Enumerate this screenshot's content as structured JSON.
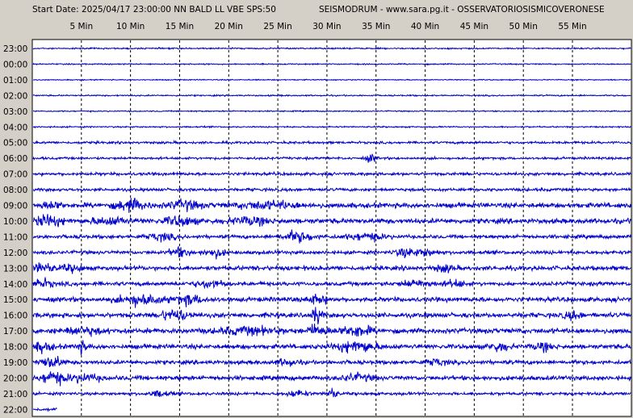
{
  "header": {
    "left": "Start Date: 2025/04/17 23:00:00 NN BALD LL VBE SPS:50",
    "right": "SEISMODRUM - www.sara.pg.it - OSSERVATORIOSISMICOVERONESE"
  },
  "colors": {
    "background": "#d4d0c8",
    "plot_background": "#ffffff",
    "trace": "#0000cc",
    "grid": "#000000"
  },
  "chart_data": {
    "type": "line",
    "title": "",
    "xlabel": "",
    "ylabel": "",
    "x_unit": "minutes",
    "xlim": [
      0,
      61
    ],
    "x_ticks": [
      {
        "value": 5,
        "label": "5 Min"
      },
      {
        "value": 10,
        "label": "10 Min"
      },
      {
        "value": 15,
        "label": "15 Min"
      },
      {
        "value": 20,
        "label": "20 Min"
      },
      {
        "value": 25,
        "label": "25 Min"
      },
      {
        "value": 30,
        "label": "30 Min"
      },
      {
        "value": 35,
        "label": "35 Min"
      },
      {
        "value": 40,
        "label": "40 Min"
      },
      {
        "value": 45,
        "label": "45 Min"
      },
      {
        "value": 50,
        "label": "50 Min"
      },
      {
        "value": 55,
        "label": "55 Min"
      }
    ],
    "grid": "vertical dashed",
    "rows": [
      {
        "label": "23:00",
        "base": 0.7,
        "bursts": []
      },
      {
        "label": "00:00",
        "base": 0.6,
        "bursts": []
      },
      {
        "label": "01:00",
        "base": 0.5,
        "bursts": []
      },
      {
        "label": "02:00",
        "base": 0.7,
        "bursts": []
      },
      {
        "label": "03:00",
        "base": 0.6,
        "bursts": []
      },
      {
        "label": "04:00",
        "base": 0.7,
        "bursts": []
      },
      {
        "label": "05:00",
        "base": 1.2,
        "bursts": []
      },
      {
        "label": "06:00",
        "base": 1.2,
        "bursts": [
          [
            34.5,
            0.5,
            4
          ]
        ]
      },
      {
        "label": "07:00",
        "base": 1.5,
        "bursts": []
      },
      {
        "label": "08:00",
        "base": 1.5,
        "bursts": []
      },
      {
        "label": "09:00",
        "base": 2.5,
        "bursts": [
          [
            10,
            1.5,
            5
          ],
          [
            15.5,
            1.5,
            4
          ],
          [
            24,
            3,
            3
          ],
          [
            2,
            1,
            3
          ]
        ]
      },
      {
        "label": "10:00",
        "base": 2.5,
        "bursts": [
          [
            1.5,
            1.5,
            5
          ],
          [
            8,
            2,
            3
          ],
          [
            15,
            1.5,
            4
          ],
          [
            22,
            2,
            3
          ]
        ]
      },
      {
        "label": "11:00",
        "base": 1.8,
        "bursts": [
          [
            13,
            1.5,
            3
          ],
          [
            27,
            1.5,
            5
          ],
          [
            34,
            2,
            3
          ]
        ]
      },
      {
        "label": "12:00",
        "base": 1.8,
        "bursts": [
          [
            15,
            1,
            4
          ],
          [
            18.5,
            1,
            4
          ],
          [
            38,
            1,
            4
          ],
          [
            40,
            1,
            3
          ]
        ]
      },
      {
        "label": "13:00",
        "base": 2.2,
        "bursts": [
          [
            1,
            1,
            5
          ],
          [
            4,
            1,
            3
          ],
          [
            42,
            1,
            3
          ]
        ]
      },
      {
        "label": "14:00",
        "base": 2.0,
        "bursts": [
          [
            1,
            1,
            4
          ],
          [
            18,
            1.5,
            3
          ],
          [
            39,
            1.5,
            3
          ],
          [
            43,
            1,
            3
          ]
        ]
      },
      {
        "label": "15:00",
        "base": 2.3,
        "bursts": [
          [
            11,
            2,
            5
          ],
          [
            16,
            1.5,
            4
          ],
          [
            29,
            1,
            4
          ]
        ]
      },
      {
        "label": "16:00",
        "base": 2.3,
        "bursts": [
          [
            14.5,
            1.5,
            5
          ],
          [
            29,
            0.5,
            8
          ],
          [
            55,
            1,
            3
          ]
        ]
      },
      {
        "label": "17:00",
        "base": 2.5,
        "bursts": [
          [
            5,
            2,
            3
          ],
          [
            22,
            3,
            3
          ],
          [
            29,
            1,
            5
          ],
          [
            33,
            1.5,
            5
          ]
        ]
      },
      {
        "label": "18:00",
        "base": 2.3,
        "bursts": [
          [
            1,
            1,
            4
          ],
          [
            5,
            0.5,
            5
          ],
          [
            33,
            2,
            5
          ],
          [
            47.5,
            1,
            4
          ],
          [
            52,
            1,
            3
          ]
        ]
      },
      {
        "label": "19:00",
        "base": 2.0,
        "bursts": [
          [
            2,
            1,
            6
          ],
          [
            26,
            1,
            3
          ],
          [
            41,
            1,
            3
          ]
        ]
      },
      {
        "label": "20:00",
        "base": 2.2,
        "bursts": [
          [
            2,
            1,
            6
          ],
          [
            5,
            2,
            3
          ],
          [
            33,
            1.5,
            3
          ]
        ]
      },
      {
        "label": "21:00",
        "base": 1.5,
        "bursts": [
          [
            13,
            1,
            3
          ],
          [
            27,
            1,
            3
          ],
          [
            30.5,
            0.5,
            5
          ]
        ]
      },
      {
        "label": "22:00",
        "base": 1.5,
        "end": 2.5,
        "bursts": []
      }
    ]
  }
}
